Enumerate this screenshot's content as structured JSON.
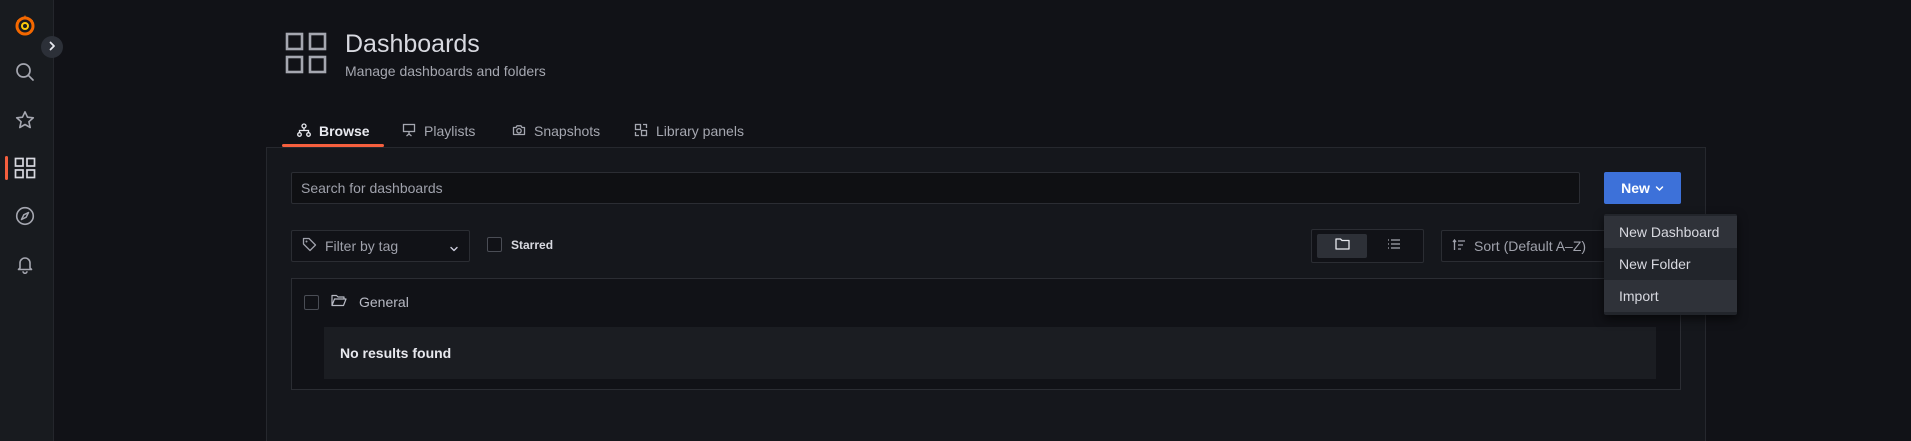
{
  "colors": {
    "accent": "#f55f3e",
    "primary_button": "#3d71d9",
    "background": "#111217",
    "sidebar": "#181b1f"
  },
  "sidebar": {
    "items": [
      {
        "icon": "grafana-logo-icon"
      },
      {
        "icon": "search-icon"
      },
      {
        "icon": "star-icon"
      },
      {
        "icon": "dashboards-icon",
        "active": true
      },
      {
        "icon": "compass-icon"
      },
      {
        "icon": "bell-icon"
      }
    ],
    "toggle_icon": "chevron-right-icon"
  },
  "header": {
    "title": "Dashboards",
    "subtitle": "Manage dashboards and folders",
    "icon": "dashboards-icon"
  },
  "tabs": [
    {
      "label": "Browse",
      "icon": "sitemap-icon",
      "active": true
    },
    {
      "label": "Playlists",
      "icon": "presentation-icon"
    },
    {
      "label": "Snapshots",
      "icon": "camera-icon"
    },
    {
      "label": "Library panels",
      "icon": "library-panels-icon"
    }
  ],
  "search": {
    "placeholder": "Search for dashboards",
    "value": ""
  },
  "new_button": {
    "label": "New"
  },
  "new_menu": {
    "items": [
      {
        "label": "New Dashboard"
      },
      {
        "label": "New Folder"
      },
      {
        "label": "Import"
      }
    ]
  },
  "filters": {
    "tag_placeholder": "Filter by tag",
    "starred_label": "Starred",
    "sort_label": "Sort (Default A–Z)",
    "view_modes": [
      "folder-view",
      "list-view"
    ],
    "active_view": "folder-view"
  },
  "folders": [
    {
      "name": "General",
      "empty_text": "No results found"
    }
  ]
}
